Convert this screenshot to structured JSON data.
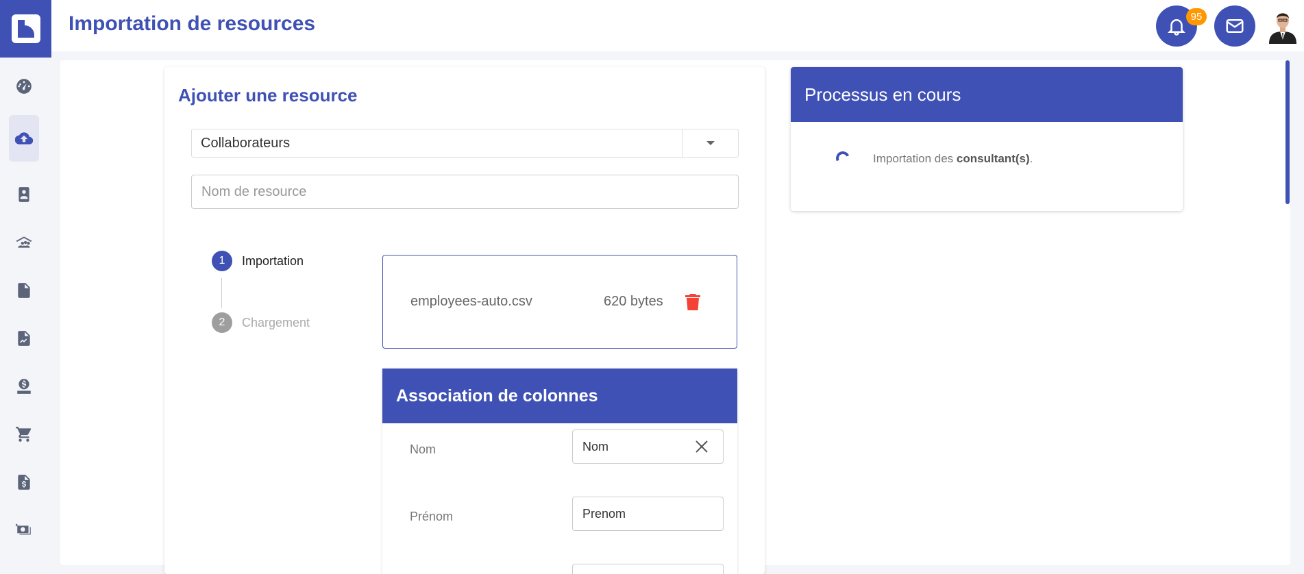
{
  "header": {
    "title": "Importation de resources",
    "notifications_count": "95",
    "notification_icon": "bell-icon",
    "mail_icon": "envelope-icon"
  },
  "sidebar": {
    "items": [
      {
        "icon": "dashboard-icon"
      },
      {
        "icon": "cloud-upload-icon",
        "active": true
      },
      {
        "icon": "contact-card-icon"
      },
      {
        "icon": "team-icon"
      },
      {
        "icon": "document-icon"
      },
      {
        "icon": "report-icon"
      },
      {
        "icon": "payment-icon"
      },
      {
        "icon": "cart-icon"
      },
      {
        "icon": "invoice-icon"
      },
      {
        "icon": "money-exchange-icon"
      }
    ]
  },
  "add_resource": {
    "title": "Ajouter une resource",
    "type_select_value": "Collaborateurs",
    "name_placeholder": "Nom de resource"
  },
  "stepper": {
    "steps": [
      {
        "number": "1",
        "label": "Importation",
        "active": true
      },
      {
        "number": "2",
        "label": "Chargement",
        "active": false
      }
    ]
  },
  "file": {
    "name": "employees-auto.csv",
    "size": "620 bytes"
  },
  "association": {
    "title": "Association de colonnes",
    "rows": [
      {
        "label": "Nom",
        "value": "Nom"
      },
      {
        "label": "Prénom",
        "value": "Prenom"
      }
    ]
  },
  "process": {
    "title": "Processus en cours",
    "text_prefix": "Importation des ",
    "text_bold": "consultant(s)",
    "text_suffix": "."
  },
  "colors": {
    "primary": "#3f51b5",
    "badge": "#ff9800",
    "danger": "#f44336"
  }
}
